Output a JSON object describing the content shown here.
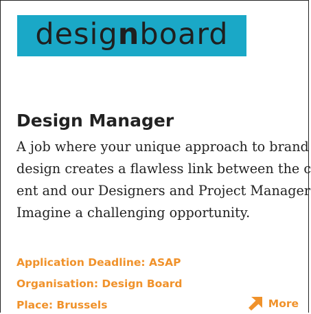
{
  "colors": {
    "logo_bg": "#1aa8c7",
    "accent": "#f0922b",
    "text": "#222222"
  },
  "logo": {
    "part1": "desig",
    "part2": "n",
    "part3": "board"
  },
  "job": {
    "title": "Design Manager",
    "description_lines": [
      "A job where your unique approach to brand",
      "design creates a flawless link between the cli-",
      "ent and our Designers and Project Managers.",
      "Imagine a challenging opportunity."
    ],
    "deadline": "Application Deadline: ASAP",
    "organisation": "Organisation: Design Board",
    "place": "Place: Brussels"
  },
  "more": {
    "label": "More",
    "icon": "arrow-up-right-icon"
  }
}
